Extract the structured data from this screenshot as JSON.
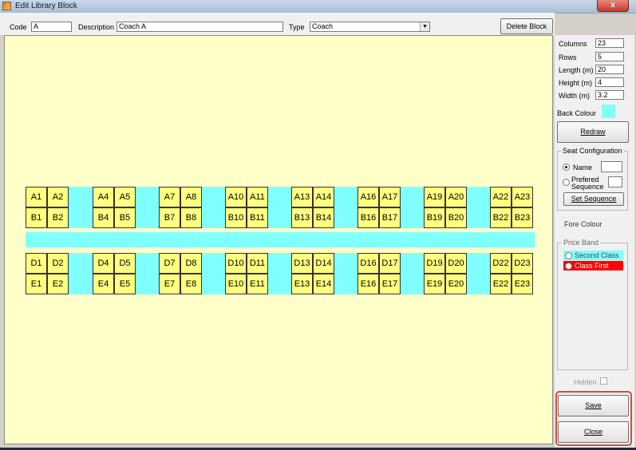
{
  "window": {
    "title": "Edit Library Block",
    "close_glyph": "x"
  },
  "toolbar": {
    "code_label": "Code",
    "code_value": "A",
    "description_label": "Description",
    "description_value": "Coach A",
    "type_label": "Type",
    "type_value": "Coach",
    "delete_label": "Delete Block"
  },
  "layout": {
    "aisle_color": "#80ffff",
    "seat_color": "#ffff80",
    "background_color": "#ffffc8",
    "seat_rows": [
      [
        "A1",
        "A2",
        "A4",
        "A5",
        "A7",
        "A8",
        "A10",
        "A11",
        "A13",
        "A14",
        "A16",
        "A17",
        "A19",
        "A20",
        "A22",
        "A23"
      ],
      [
        "B1",
        "B2",
        "B4",
        "B5",
        "B7",
        "B8",
        "B10",
        "B11",
        "B13",
        "B14",
        "B16",
        "B17",
        "B19",
        "B20",
        "B22",
        "B23"
      ],
      [
        "D1",
        "D2",
        "D4",
        "D5",
        "D7",
        "D8",
        "D10",
        "D11",
        "D13",
        "D14",
        "D16",
        "D17",
        "D19",
        "D20",
        "D22",
        "D23"
      ],
      [
        "E1",
        "E2",
        "E4",
        "E5",
        "E7",
        "E8",
        "E10",
        "E11",
        "E13",
        "E14",
        "E16",
        "E17",
        "E19",
        "E20",
        "E22",
        "E23"
      ]
    ]
  },
  "props": {
    "columns_label": "Columns",
    "columns_value": "23",
    "rows_label": "Rows",
    "rows_value": "5",
    "length_label": "Length (m)",
    "length_value": "20",
    "height_label": "Height (m)",
    "height_value": "4",
    "width_label": "Width (m)",
    "width_value": "3.2",
    "back_colour_label": "Back Colour",
    "back_colour": "#80ffff",
    "redraw_label": "Redraw"
  },
  "seat_config": {
    "title": "Seat Configuration",
    "name_label": "Name",
    "name_value": "",
    "preferred_label_1": "Prefered",
    "preferred_label_2": "Sequence",
    "preferred_value": "",
    "set_sequence_label": "Set Sequence",
    "fore_colour_label": "Fore Colour"
  },
  "price_band": {
    "title": "Price Band",
    "items": [
      {
        "label": "Second Class",
        "color": "#80ffff",
        "text_color": "#444444"
      },
      {
        "label": "Class First",
        "color": "#ff0000",
        "text_color": "#ffffff"
      }
    ]
  },
  "footer": {
    "hidden_label": "Hidden",
    "save_label": "Save",
    "close_label": "Close"
  }
}
